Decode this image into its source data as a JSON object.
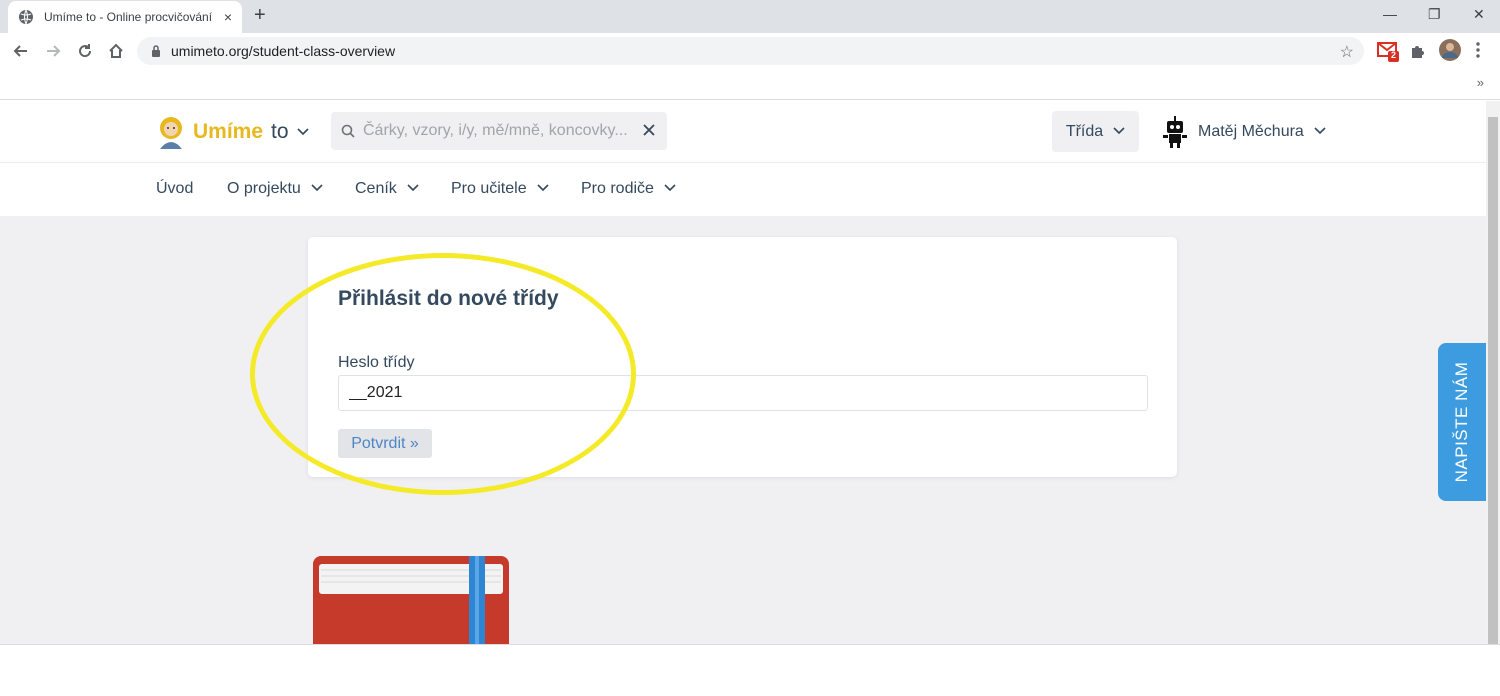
{
  "browser": {
    "tab_title": "Umíme to - Online procvičování",
    "url": "umimeto.org/student-class-overview",
    "new_tab": "+",
    "tab_close": "×",
    "minimize": "—",
    "maximize": "❐",
    "window_close": "✕",
    "ext_badge": "2",
    "bookmarks_more": "»"
  },
  "header": {
    "brand_main": "Umíme",
    "brand_suffix": "to",
    "search_placeholder": "Čárky, vzory, i/y, mě/mně, koncovky...",
    "class_button": "Třída",
    "user_name": "Matěj Měchura"
  },
  "nav": {
    "items": [
      {
        "label": "Úvod",
        "has_dropdown": false
      },
      {
        "label": "O projektu",
        "has_dropdown": true
      },
      {
        "label": "Ceník",
        "has_dropdown": true
      },
      {
        "label": "Pro učitele",
        "has_dropdown": true
      },
      {
        "label": "Pro rodiče",
        "has_dropdown": true
      }
    ]
  },
  "form": {
    "title": "Přihlásit do nové třídy",
    "password_label": "Heslo třídy",
    "password_value": "__2021",
    "submit_label": "Potvrdit  »"
  },
  "feedback_tab": "NAPIŠTE NÁM",
  "colors": {
    "brand_yellow": "#e8b820",
    "highlight": "#f4ea27",
    "feedback_blue": "#3d9be0",
    "page_bg": "#f0f0f2"
  },
  "icons": [
    "globe-icon",
    "lock-icon",
    "star-icon",
    "gmail-icon",
    "extensions-icon",
    "profile-avatar",
    "menu-dots-icon",
    "search-icon",
    "clear-icon",
    "robot-avatar",
    "book-illustration"
  ]
}
